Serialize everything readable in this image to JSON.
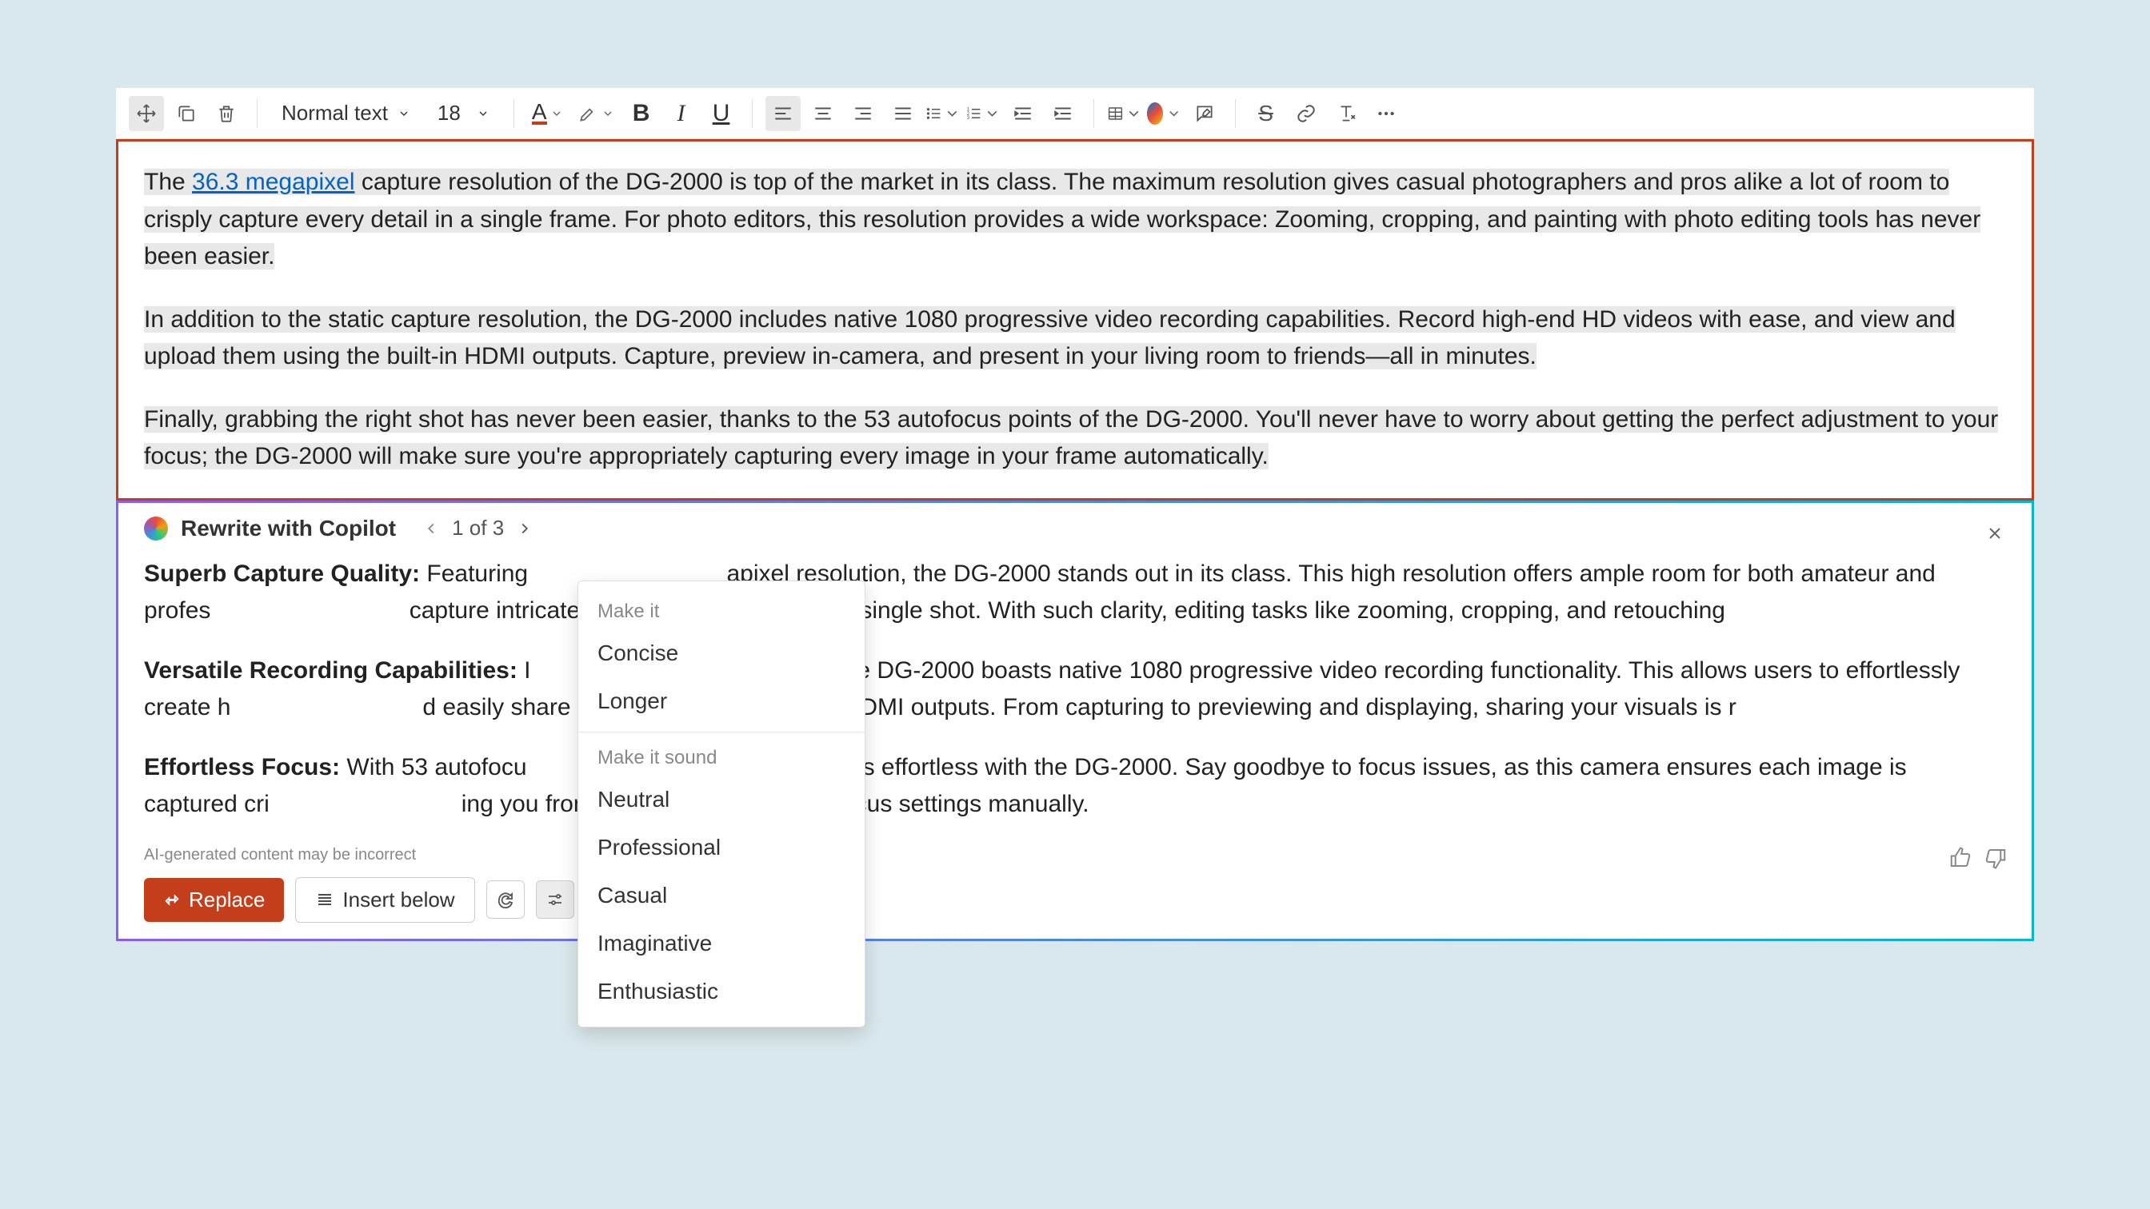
{
  "toolbar": {
    "text_style": "Normal text",
    "font_size": "18"
  },
  "document": {
    "p1_a": "The ",
    "p1_link": "36.3 megapixel",
    "p1_b": " capture resolution of the DG-2000 is top of the market in its class. The maximum resolution gives casual photographers and pros alike a lot of room to crisply capture every detail in a single frame. For photo editors, this resolution provides a wide workspace: Zooming, cropping, and painting with photo editing tools has never been easier.",
    "p2": "In addition to the static capture resolution, the DG-2000 includes native 1080 progressive video recording capabilities. Record high-end HD videos with ease, and view and upload them using the built-in HDMI outputs. Capture, preview in-camera, and present in your living room to friends—all in minutes.",
    "p3": "Finally, grabbing the right shot has never been easier, thanks to the 53 autofocus points of the DG-2000. You'll never have to worry about getting the perfect adjustment to your focus; the DG-2000 will make sure you're appropriately capturing every image in your frame automatically."
  },
  "copilot": {
    "title": "Rewrite with Copilot",
    "counter": "1 of 3",
    "p1_h": "Superb Capture Quality:",
    "p1_t": " Featuring ",
    "p1_t2": "apixel resolution, the DG-2000 stands out in its class. This high resolution offers ample room for both amateur and profes",
    "p1_t3": " capture intricate details with precision in a single shot. With such clarity, editing tasks like zooming, cropping, and retouching",
    "p2_h": "Versatile Recording Capabilities:",
    "p2_t": " I",
    "p2_t2": "ge quality, the DG-2000 boasts native 1080 progressive video recording functionality. This allows users to effortlessly create h",
    "p2_t3": "d easily share them through the built-in HDMI outputs. From capturing to previewing and displaying, sharing your visuals is r",
    "p3_h": "Effortless Focus:",
    "p3_t": " With 53 autofocu",
    "p3_t2": "fect moment is effortless with the DG-2000. Say goodbye to focus issues, as this camera ensures each image is captured cri",
    "p3_t3": "ing you from the worry of adjusting focus settings manually.",
    "disclaimer": "AI-generated content may be incorrect",
    "replace": "Replace",
    "insert": "Insert below"
  },
  "tone_menu": {
    "section1": "Make it",
    "concise": "Concise",
    "longer": "Longer",
    "section2": "Make it sound",
    "neutral": "Neutral",
    "professional": "Professional",
    "casual": "Casual",
    "imaginative": "Imaginative",
    "enthusiastic": "Enthusiastic"
  }
}
